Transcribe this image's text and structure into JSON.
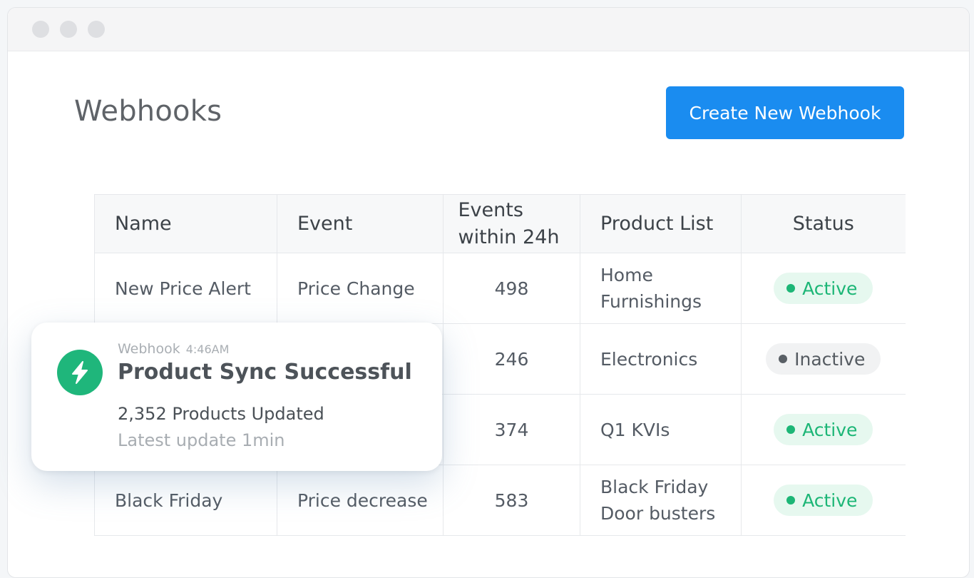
{
  "page": {
    "title": "Webhooks",
    "create_button": "Create New Webhook"
  },
  "table": {
    "columns": [
      "Name",
      "Event",
      "Events within 24h",
      "Product List",
      "Status"
    ],
    "rows": [
      {
        "name": "New Price Alert",
        "event": "Price Change",
        "count": "498",
        "product_list": "Home Furnishings",
        "status": "Active"
      },
      {
        "name": "",
        "event": "",
        "count": "246",
        "product_list": "Electronics",
        "status": "Inactive"
      },
      {
        "name": "",
        "event": "",
        "count": "374",
        "product_list": "Q1 KVIs",
        "status": "Active"
      },
      {
        "name": "Black Friday",
        "event": "Price decrease",
        "count": "583",
        "product_list": "Black Friday Door busters",
        "status": "Active"
      }
    ]
  },
  "toast": {
    "source": "Webhook",
    "time": "4:46AM",
    "title": "Product Sync Successful",
    "line1": "2,352 Products Updated",
    "line2": "Latest update 1min",
    "icon": "lightning-bolt-icon"
  },
  "colors": {
    "primary": "#1a8cf0",
    "active": "#1cb676",
    "active_bg": "#e6f8ef",
    "inactive": "#595f65",
    "inactive_bg": "#f1f2f3",
    "toast_icon": "#1fb67b"
  }
}
